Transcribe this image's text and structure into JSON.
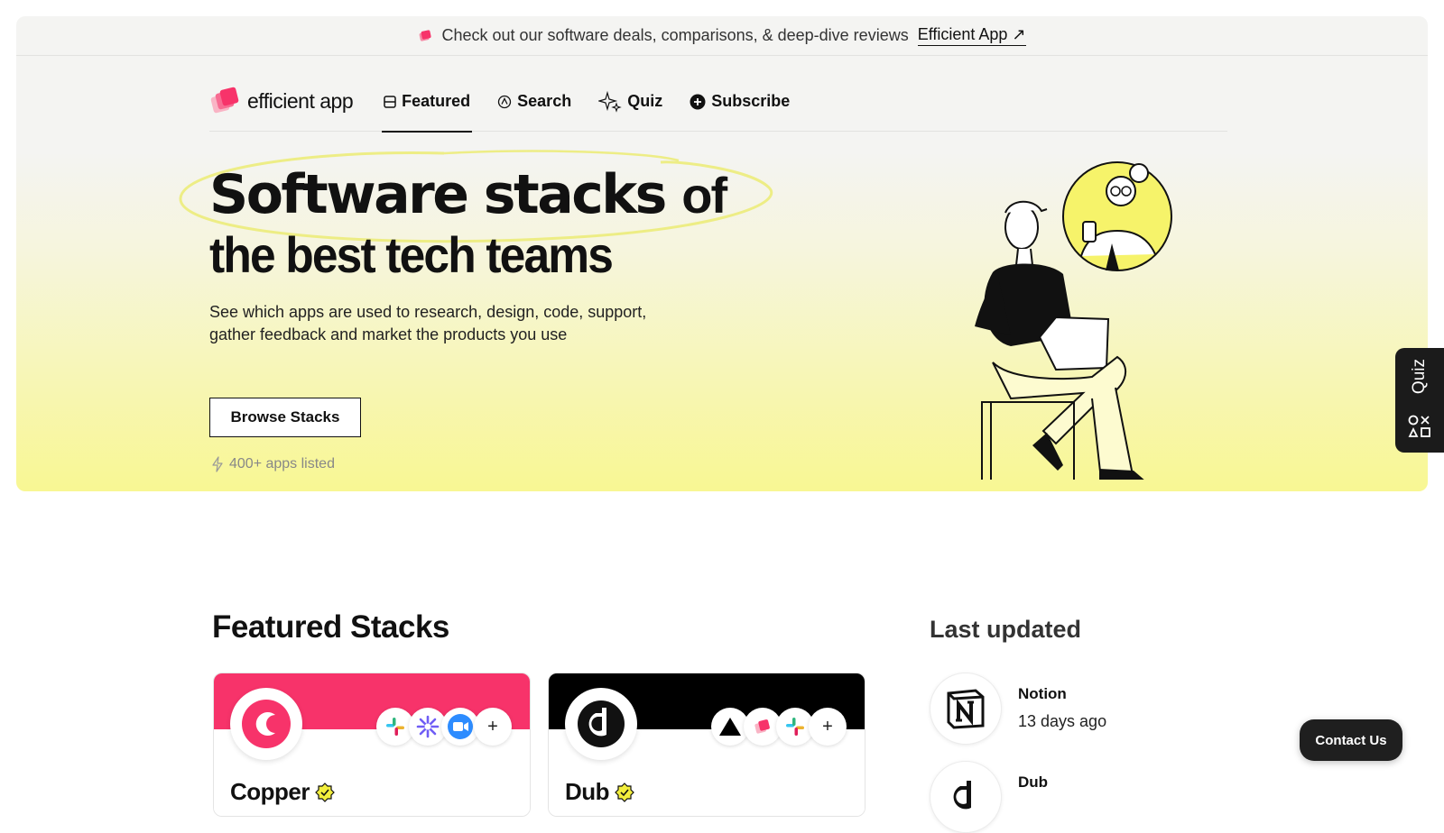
{
  "announcement": {
    "text": "Check out our software deals, comparisons, & deep-dive reviews",
    "link_label": "Efficient App ↗"
  },
  "brand": {
    "name": "efficient app"
  },
  "nav": {
    "items": [
      {
        "label": "Featured",
        "icon": "featured-icon",
        "active": true
      },
      {
        "label": "Search",
        "icon": "search-icon",
        "active": false
      },
      {
        "label": "Quiz",
        "icon": "sparkle-icon",
        "active": false
      },
      {
        "label": "Subscribe",
        "icon": "plus-circle-icon",
        "active": false
      }
    ]
  },
  "hero": {
    "headline_part1": "Software stacks",
    "headline_part2": "of",
    "headline_line2": "the best tech teams",
    "subtitle": "See which apps are used to research, design, code, support, gather feedback and market the products you use",
    "cta_label": "Browse Stacks",
    "apps_count": "400+ apps listed"
  },
  "quiz_tab": {
    "label": "Quiz"
  },
  "featured": {
    "title": "Featured Stacks",
    "cards": [
      {
        "name": "Copper",
        "banner_color": "#f7336a",
        "apps": [
          "slack-icon",
          "asterisk-icon",
          "zoom-icon"
        ],
        "more": "+"
      },
      {
        "name": "Dub",
        "banner_color": "#000000",
        "apps": [
          "triangle-icon",
          "efficient-app-icon",
          "slack-icon"
        ],
        "more": "+"
      }
    ]
  },
  "last_updated": {
    "title": "Last updated",
    "items": [
      {
        "name": "Notion",
        "time": "13 days ago"
      },
      {
        "name": "Dub",
        "time": ""
      }
    ]
  },
  "contact": {
    "label": "Contact Us"
  },
  "colors": {
    "accent_pink": "#f7336a",
    "hero_yellow": "#f8f793",
    "dark": "#1b1b1b"
  }
}
